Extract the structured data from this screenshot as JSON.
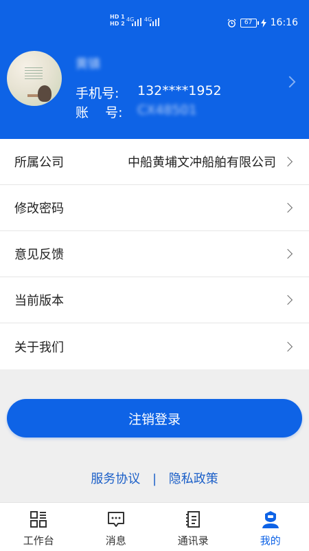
{
  "status_bar": {
    "hd_top": "HD 1",
    "hd_bottom": "HD 2",
    "net1": "4G",
    "net2": "4G",
    "battery": "67",
    "time": "16:16"
  },
  "profile": {
    "name": "黄镇",
    "phone_label": "手机号:",
    "phone_value": "132****1952",
    "account_label": "账    号:",
    "account_value": "CX48501"
  },
  "menu": {
    "items": [
      {
        "label": "所属公司",
        "value": "中船黄埔文冲船舶有限公司"
      },
      {
        "label": "修改密码",
        "value": ""
      },
      {
        "label": "意见反馈",
        "value": ""
      },
      {
        "label": "当前版本",
        "value": ""
      },
      {
        "label": "关于我们",
        "value": ""
      }
    ]
  },
  "logout_label": "注销登录",
  "links": {
    "service": "服务协议",
    "separator": "|",
    "privacy": "隐私政策"
  },
  "tabs": [
    {
      "label": "工作台",
      "icon": "workbench-icon",
      "active": false
    },
    {
      "label": "消息",
      "icon": "message-icon",
      "active": false
    },
    {
      "label": "通讯录",
      "icon": "contacts-icon",
      "active": false
    },
    {
      "label": "我的",
      "icon": "profile-icon",
      "active": true
    }
  ],
  "colors": {
    "primary": "#0e63e6",
    "link": "#1b5fc8",
    "background": "#efefef"
  }
}
